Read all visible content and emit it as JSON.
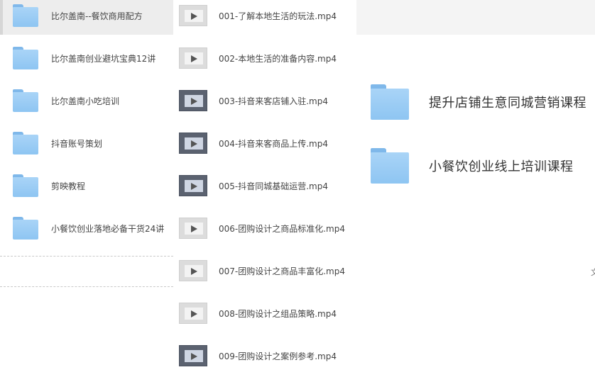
{
  "left_folders": [
    {
      "label": "比尔盖南--餐饮商用配方"
    },
    {
      "label": "比尔盖南创业避坑宝典12讲"
    },
    {
      "label": "比尔盖南小吃培训"
    },
    {
      "label": "抖音账号策划"
    },
    {
      "label": "剪映教程"
    },
    {
      "label": "小餐饮创业落地必备干货24讲"
    }
  ],
  "videos": [
    {
      "label": "001-了解本地生活的玩法.mp4",
      "icon": "video-thumbnail-icon"
    },
    {
      "label": "002-本地生活的准备内容.mp4",
      "icon": "video-thumbnail-icon"
    },
    {
      "label": "003-抖音来客店铺入驻.mp4",
      "icon": "video-thumbnail-icon"
    },
    {
      "label": "004-抖音来客商品上传.mp4",
      "icon": "video-thumbnail-icon"
    },
    {
      "label": "005-抖音同城基础运营.mp4",
      "icon": "video-thumbnail-icon"
    },
    {
      "label": "006-团购设计之商品标准化.mp4",
      "icon": "video-thumbnail-icon"
    },
    {
      "label": "007-团购设计之商品丰富化.mp4",
      "icon": "video-thumbnail-icon"
    },
    {
      "label": "008-团购设计之组品策略.mp4",
      "icon": "video-thumbnail-icon"
    },
    {
      "label": "009-团购设计之案例参考.mp4",
      "icon": "video-thumbnail-icon"
    }
  ],
  "right_folders": [
    {
      "label": "提升店铺生意同城营销课程"
    },
    {
      "label": "小餐饮创业线上培训课程"
    }
  ],
  "right_edge_glyph": "文",
  "colors": {
    "folder": "#8ec5f2",
    "folder_tab": "#7fb8ea",
    "selected_row": "#ededed"
  }
}
